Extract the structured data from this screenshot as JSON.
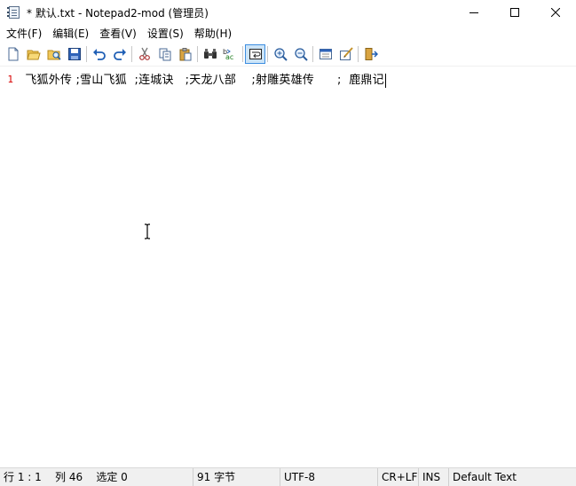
{
  "window": {
    "title": "* 默认.txt - Notepad2-mod (管理员)",
    "controls": {
      "minimize": "minimize",
      "maximize": "maximize",
      "close": "close"
    }
  },
  "menu": {
    "items": [
      "文件(F)",
      "编辑(E)",
      "查看(V)",
      "设置(S)",
      "帮助(H)"
    ]
  },
  "toolbar": {
    "buttons": [
      {
        "name": "new-file-icon"
      },
      {
        "name": "open-folder-icon"
      },
      {
        "name": "browse-icon"
      },
      {
        "name": "save-icon"
      },
      {
        "name": "undo-icon"
      },
      {
        "name": "redo-icon"
      },
      {
        "name": "cut-icon"
      },
      {
        "name": "copy-icon"
      },
      {
        "name": "paste-icon"
      },
      {
        "name": "find-icon"
      },
      {
        "name": "replace-icon"
      },
      {
        "name": "word-wrap-icon",
        "active": true
      },
      {
        "name": "zoom-in-icon"
      },
      {
        "name": "zoom-out-icon"
      },
      {
        "name": "scheme-icon"
      },
      {
        "name": "customize-scheme-icon"
      },
      {
        "name": "exit-icon"
      }
    ]
  },
  "editor": {
    "line_number": "1",
    "text": " 飞狐外传 ;雪山飞狐  ;连城诀   ;天龙八部    ;射雕英雄传      ;  鹿鼎记"
  },
  "status": {
    "position": "行 1 : 1    列 46    选定 0",
    "bytes": "91 字节",
    "encoding": "UTF-8",
    "line_endings": "CR+LF",
    "mode": "INS",
    "scheme": "Default Text"
  },
  "colors": {
    "line_number": "#d80000",
    "active_button_bg": "#cce4f7",
    "statusbar_bg": "#f0f0f0"
  }
}
